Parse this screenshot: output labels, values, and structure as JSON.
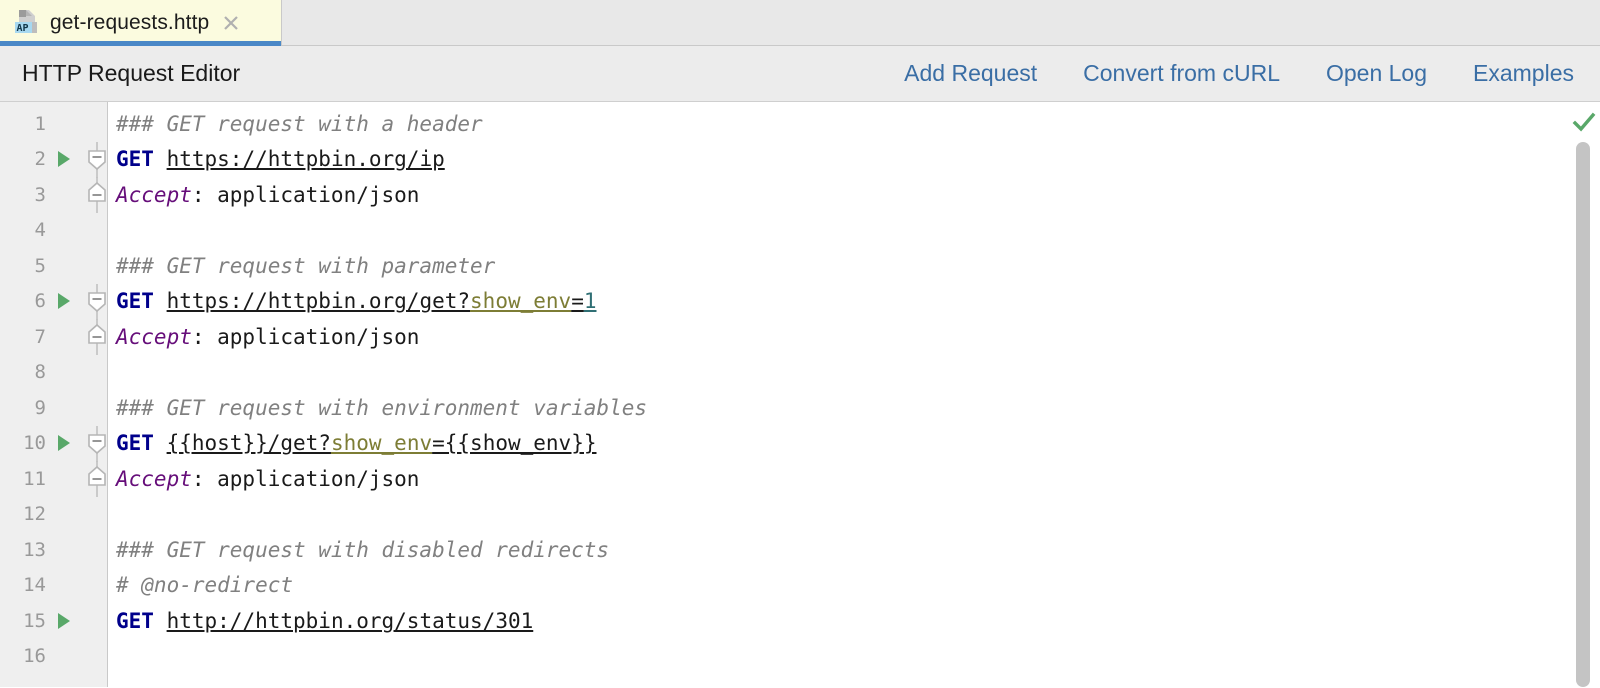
{
  "tab": {
    "title": "get-requests.http",
    "icon": "http-file-icon",
    "icon_badge": "AP",
    "close_icon": "close-icon",
    "active_accent": "#4a88c7",
    "background": "#fbfbdf"
  },
  "toolbar": {
    "title": "HTTP Request Editor",
    "link_color": "#3a6ea5",
    "actions": [
      {
        "label": "Add Request",
        "name": "add-request-link"
      },
      {
        "label": "Convert from cURL",
        "name": "convert-from-curl-link"
      },
      {
        "label": "Open Log",
        "name": "open-log-link"
      },
      {
        "label": "Examples",
        "name": "examples-link"
      }
    ]
  },
  "editor": {
    "line_count": 16,
    "line_numbers": [
      "1",
      "2",
      "3",
      "4",
      "5",
      "6",
      "7",
      "8",
      "9",
      "10",
      "11",
      "12",
      "13",
      "14",
      "15",
      "16"
    ],
    "run_arrow_lines": [
      2,
      6,
      10,
      15
    ],
    "fold_start_lines": [
      2,
      6,
      10
    ],
    "fold_end_lines": [
      3,
      7,
      11
    ],
    "colors": {
      "comment": "#808080",
      "method": "#00008b",
      "url": "#1a1a1a",
      "query_param": "#7d7d35",
      "query_value": "#2f6f74",
      "header_name": "#660e7a",
      "gutter_bg": "#efefef",
      "editor_bg": "#ffffff"
    },
    "lines": [
      {
        "n": "1",
        "tokens": [
          {
            "t": "### GET request with a header",
            "c": "comment"
          }
        ]
      },
      {
        "n": "2",
        "tokens": [
          {
            "t": "GET",
            "c": "method"
          },
          {
            "t": " ",
            "c": "sp"
          },
          {
            "t": "https://httpbin.org/ip",
            "c": "url"
          }
        ]
      },
      {
        "n": "3",
        "tokens": [
          {
            "t": "Accept",
            "c": "header"
          },
          {
            "t": ": application/json",
            "c": "plain"
          }
        ]
      },
      {
        "n": "4",
        "tokens": []
      },
      {
        "n": "5",
        "tokens": [
          {
            "t": "### GET request with parameter",
            "c": "comment"
          }
        ]
      },
      {
        "n": "6",
        "tokens": [
          {
            "t": "GET",
            "c": "method"
          },
          {
            "t": " ",
            "c": "sp"
          },
          {
            "t": "https://httpbin.org/get?",
            "c": "url"
          },
          {
            "t": "show_env",
            "c": "param"
          },
          {
            "t": "=",
            "c": "eq"
          },
          {
            "t": "1",
            "c": "val"
          }
        ]
      },
      {
        "n": "7",
        "tokens": [
          {
            "t": "Accept",
            "c": "header"
          },
          {
            "t": ": application/json",
            "c": "plain"
          }
        ]
      },
      {
        "n": "8",
        "tokens": []
      },
      {
        "n": "9",
        "tokens": [
          {
            "t": "### GET request with environment variables",
            "c": "comment"
          }
        ]
      },
      {
        "n": "10",
        "tokens": [
          {
            "t": "GET",
            "c": "method"
          },
          {
            "t": " ",
            "c": "sp"
          },
          {
            "t": "{{host}}/get?",
            "c": "url"
          },
          {
            "t": "show_env",
            "c": "param"
          },
          {
            "t": "={{show_env}}",
            "c": "eq"
          }
        ]
      },
      {
        "n": "11",
        "tokens": [
          {
            "t": "Accept",
            "c": "header"
          },
          {
            "t": ": application/json",
            "c": "plain"
          }
        ]
      },
      {
        "n": "12",
        "tokens": []
      },
      {
        "n": "13",
        "tokens": [
          {
            "t": "### GET request with disabled redirects",
            "c": "comment"
          }
        ]
      },
      {
        "n": "14",
        "tokens": [
          {
            "t": "# @no-redirect",
            "c": "comment"
          }
        ]
      },
      {
        "n": "15",
        "tokens": [
          {
            "t": "GET",
            "c": "method"
          },
          {
            "t": " ",
            "c": "sp"
          },
          {
            "t": "http://httpbin.org/status/301",
            "c": "url"
          }
        ]
      },
      {
        "n": "16",
        "tokens": []
      }
    ]
  },
  "right_rail": {
    "inspection_icon": "checkmark-icon",
    "inspection_status": "ok",
    "inspection_color": "#59a869",
    "scrollbar_thumb_color": "#c4c4c4"
  }
}
